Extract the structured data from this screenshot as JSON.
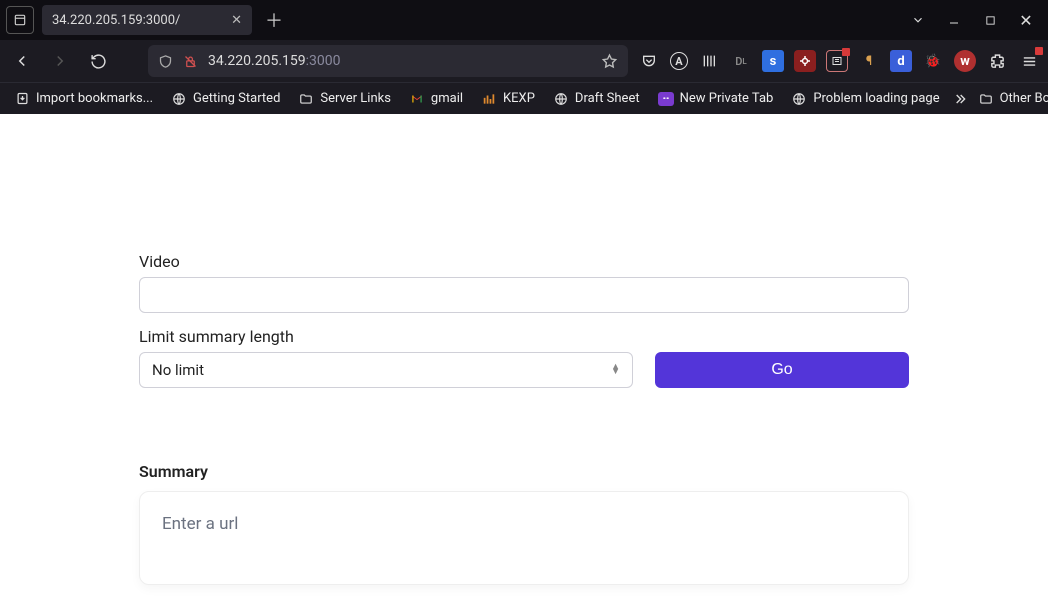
{
  "browser": {
    "tab_title": "34.220.205.159:3000/",
    "url_host": "34.220.205.159",
    "url_port": ":3000"
  },
  "bookmarks": {
    "import": "Import bookmarks...",
    "items": [
      "Getting Started",
      "Server Links",
      "gmail",
      "KEXP",
      "Draft Sheet",
      "New Private Tab",
      "Problem loading page"
    ],
    "other": "Other Bookmarks"
  },
  "form": {
    "video_label": "Video",
    "video_value": "",
    "limit_label": "Limit summary length",
    "limit_selected": "No limit",
    "go_label": "Go"
  },
  "summary": {
    "heading": "Summary",
    "placeholder": "Enter a url"
  }
}
